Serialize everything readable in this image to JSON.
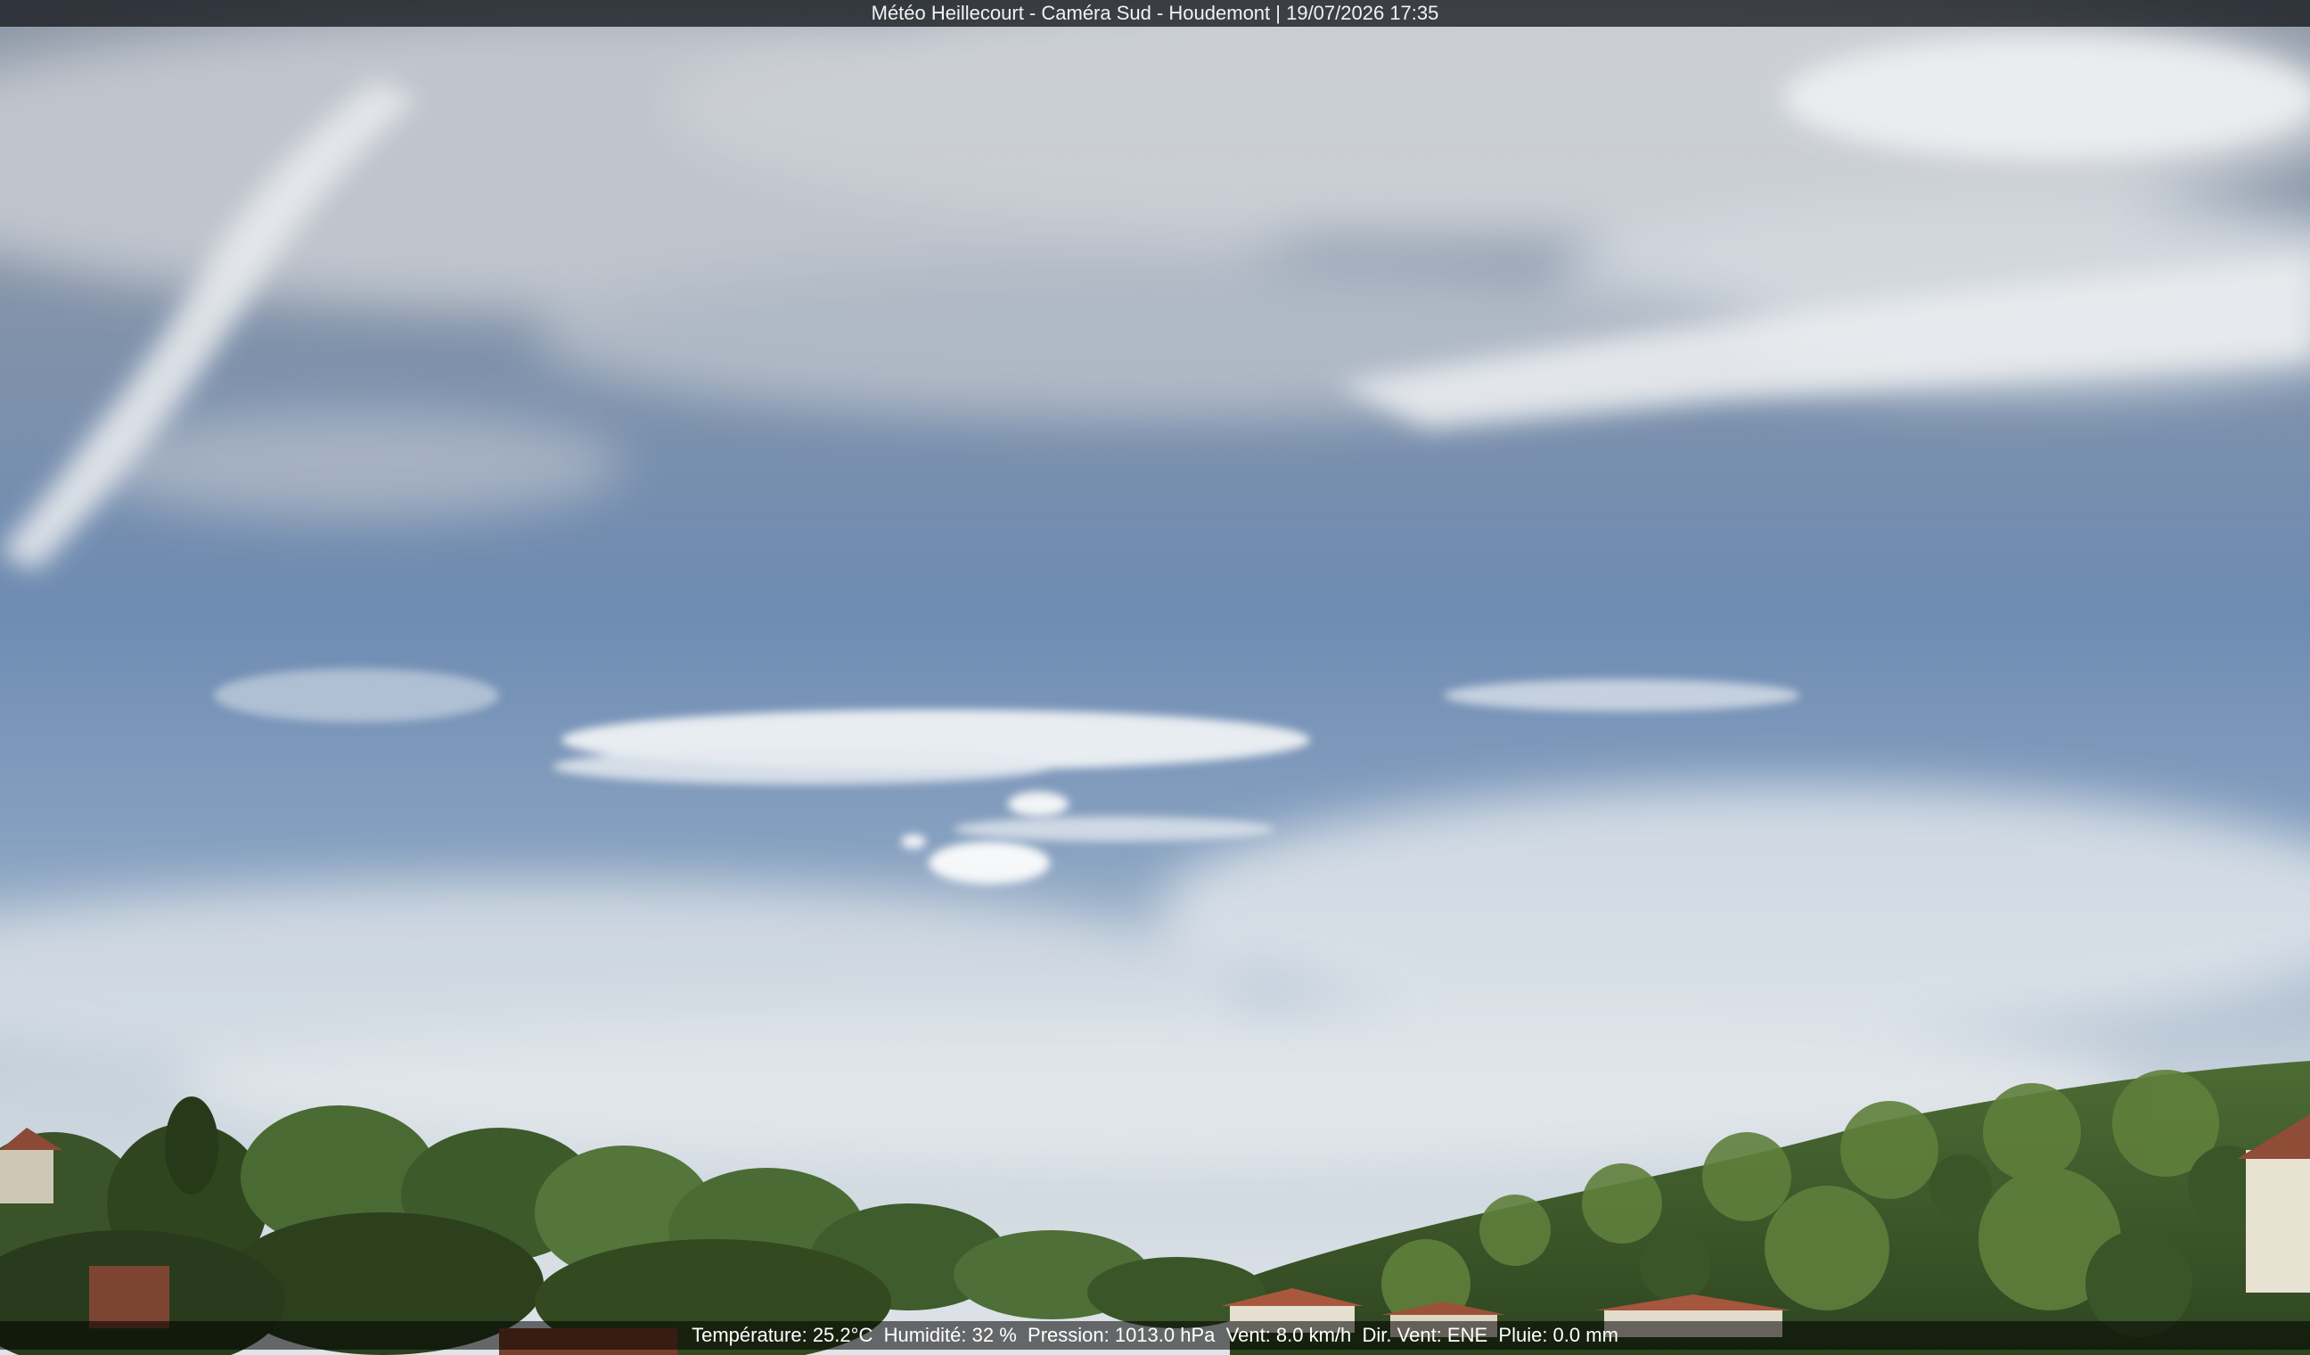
{
  "overlay": {
    "title": "Météo Heillecourt - Caméra Sud - Houdemont | 19/07/2026 17:35"
  },
  "readings": {
    "temperature": "Température: 25.2°C",
    "humidity": "Humidité: 32 %",
    "pressure": "Pression: 1013.0 hPa",
    "wind_speed": "Vent: 8.0 km/h",
    "wind_direction": "Dir. Vent: ENE",
    "rain": "Pluie: 0.0 mm"
  },
  "colors": {
    "sky_top": "#8d99ab",
    "sky_mid": "#6f8cb3",
    "sky_horizon": "#d3dbe2",
    "cloud": "#eef1f4",
    "foliage_dark": "#2f4a22",
    "foliage_light": "#6f8f45",
    "roof": "#a9583d",
    "wall": "#e8e2d2"
  }
}
